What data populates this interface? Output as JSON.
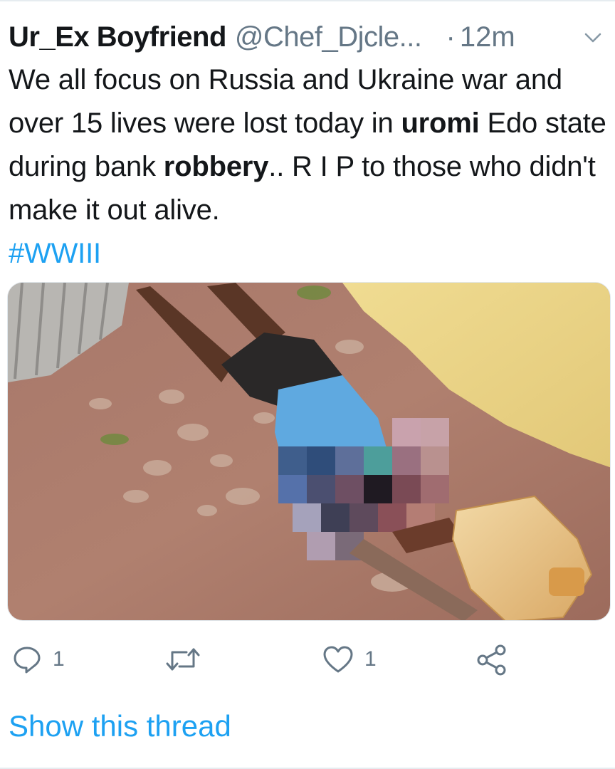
{
  "tweet": {
    "display_name": "Ur_Ex Boyfriend",
    "handle": "@Chef_Djcle...",
    "dot": "·",
    "time": "12m",
    "text_segments": [
      "We all focus on Russia and Ukraine war and over 15 lives were lost today in ",
      "uromi",
      " Edo state during bank ",
      "robbery",
      ".. R I P to those who didn't make it out alive."
    ],
    "hashtag": "#WWIII",
    "media_icon": "photo-blurred-content",
    "actions": {
      "reply_icon": "reply-icon",
      "reply_count": "1",
      "retweet_icon": "retweet-icon",
      "like_icon": "heart-icon",
      "like_count": "1",
      "share_icon": "share-icon"
    },
    "show_thread": "Show this thread"
  },
  "colors": {
    "accent": "#1da1f2",
    "text": "#14171a",
    "muted": "#657786",
    "divider": "#e6ecf0"
  }
}
